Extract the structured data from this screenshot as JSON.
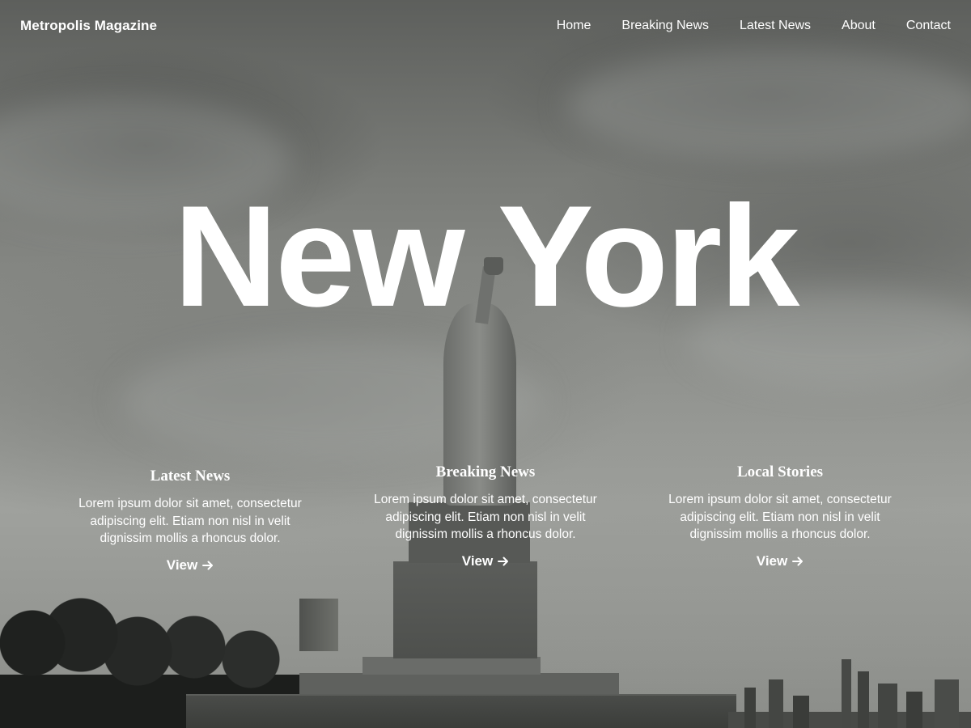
{
  "header": {
    "site_title": "Metropolis Magazine",
    "nav": [
      {
        "label": "Home"
      },
      {
        "label": "Breaking News"
      },
      {
        "label": "Latest News"
      },
      {
        "label": "About"
      },
      {
        "label": "Contact"
      }
    ]
  },
  "hero": {
    "title": "New York"
  },
  "columns": [
    {
      "heading": "Latest News",
      "text": "Lorem ipsum dolor sit amet, consectetur adipiscing elit. Etiam non nisl in velit dignissim mollis a rhoncus dolor.",
      "link_label": "View",
      "link_icon": "arrow-right-icon"
    },
    {
      "heading": "Breaking News",
      "text": "Lorem ipsum dolor sit amet, consectetur adipiscing elit. Etiam non nisl in velit dignissim mollis a rhoncus dolor.",
      "link_label": "View",
      "link_icon": "arrow-right-icon"
    },
    {
      "heading": "Local Stories",
      "text": "Lorem ipsum dolor sit amet, consectetur adipiscing elit. Etiam non nisl in velit dignissim mollis a rhoncus dolor.",
      "link_label": "View",
      "link_icon": "arrow-right-icon"
    }
  ],
  "colors": {
    "text": "#ffffff",
    "background_tint": "#8a8b88"
  }
}
